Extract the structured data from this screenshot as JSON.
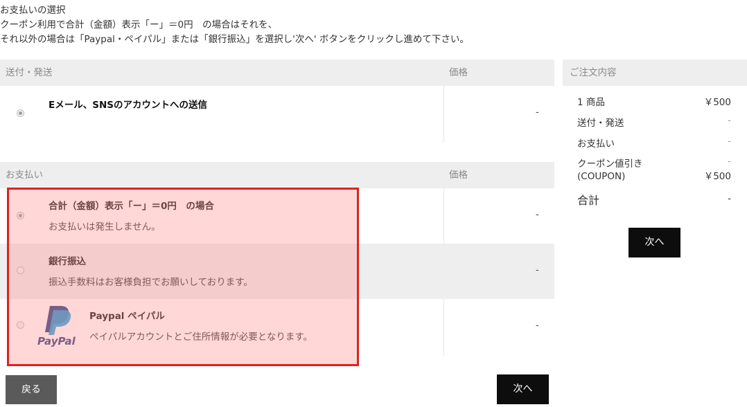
{
  "intro": {
    "line1": "お支払いの選択",
    "line2": "クーポン利用で合計（金額）表示「ー」＝0円　の場合はそれを、",
    "line3": "それ以外の場合は「Paypal・ペイパル」または「銀行振込」を選択し'次へ' ボタンをクリックし進めて下さい。"
  },
  "shipping": {
    "header_label": "送付・発送",
    "header_price": "価格",
    "options": [
      {
        "title": "Eメール、SNSのアカウントへの送信",
        "price": "-",
        "selected": true
      }
    ]
  },
  "payment": {
    "header_label": "お支払い",
    "header_price": "価格",
    "options": [
      {
        "title": "合計（金額）表示「ー」＝0円　の場合",
        "desc": "お支払いは発生しません。",
        "price": "-",
        "selected": true
      },
      {
        "title": "銀行振込",
        "desc": "振込手数料はお客様負担でお願いしております。",
        "price": "-",
        "selected": false
      },
      {
        "title": "Paypal ペイパル",
        "desc": "ペイパルアカウントとご住所情報が必要となります。",
        "price": "-",
        "selected": false,
        "logo_text": "PayPal"
      }
    ]
  },
  "summary": {
    "header": "ご注文内容",
    "items": [
      {
        "label": "1 商品",
        "value": "￥500"
      },
      {
        "label": "送付・発送",
        "value": "-"
      },
      {
        "label": "お支払い",
        "value": "-"
      },
      {
        "label": "クーポン値引き",
        "sublabel": "(COUPON)",
        "value_top": "-",
        "value": "￥500"
      },
      {
        "label": "合計",
        "value": "-"
      }
    ],
    "next_button": "次へ"
  },
  "footer": {
    "back_button": "戻る",
    "next_button": "次へ"
  },
  "colors": {
    "highlight_border": "#e02020",
    "highlight_fill": "#f9c9c9",
    "header_bg": "#eeeeee",
    "button_black": "#0d0d0d",
    "button_gray": "#5a5a5a",
    "paypal_dark": "#253b80",
    "paypal_light": "#179bd7"
  }
}
